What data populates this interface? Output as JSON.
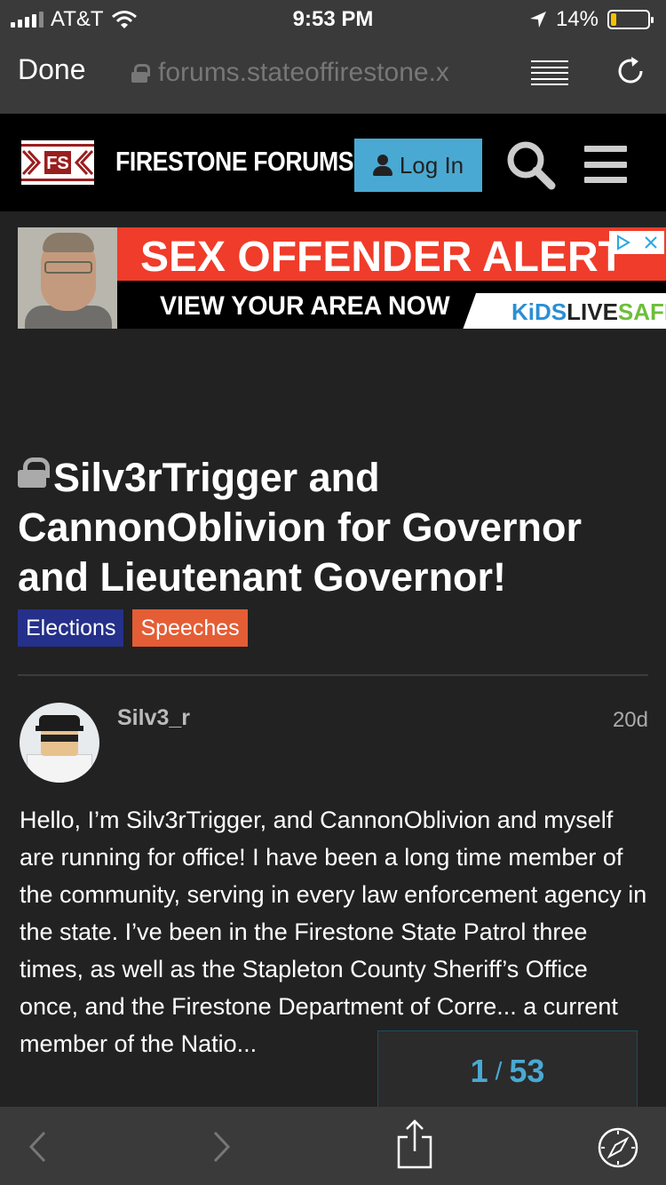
{
  "status_bar": {
    "carrier": "AT&T",
    "time": "9:53 PM",
    "battery": "14%",
    "battery_level": 0.14,
    "icons": [
      "signal-icon",
      "wifi-icon",
      "location-arrow-icon",
      "battery-icon"
    ]
  },
  "browser": {
    "done_label": "Done",
    "url": "forums.stateoffirestone.x",
    "icons": [
      "lock-icon",
      "reader-mode-icon",
      "reload-icon"
    ]
  },
  "forum_header": {
    "logo_text": "FS",
    "title": "FIRESTONE FORUMS",
    "login_label": "Log In",
    "icons": [
      "user-icon",
      "search-icon",
      "menu-icon"
    ]
  },
  "ad": {
    "headline": "SEX OFFENDER ALERT",
    "cta": "VIEW YOUR AREA NOW",
    "brand_part1": "KiDS",
    "brand_part2": "LIVE",
    "brand_part3": "SAFE",
    "icons": [
      "adchoices-icon",
      "close-icon"
    ]
  },
  "topic": {
    "title": "Silv3rTrigger and CannonOblivion for Governor and Lieutenant Governor!",
    "tags": [
      "Elections",
      "Speeches"
    ],
    "colors": {
      "elections": "#25308a",
      "speeches": "#e45d35"
    }
  },
  "post": {
    "username": "Silv3_r",
    "age": "20d",
    "body": "Hello, I’m Silv3rTrigger, and CannonOblivion and myself are running for office! I have been a long time member of the community, serving in every law enforcement agency in the state. I’ve been in the Firestone State Patrol three times, as well as the Stapleton County Sheriff’s Office once, and the Firestone Department of Corre... a current member of the Natio..."
  },
  "progress": {
    "current": "1",
    "separator": "/",
    "total": "53"
  },
  "toolbar": {
    "icons": [
      "back-icon",
      "forward-icon",
      "share-icon",
      "compass-icon"
    ]
  }
}
